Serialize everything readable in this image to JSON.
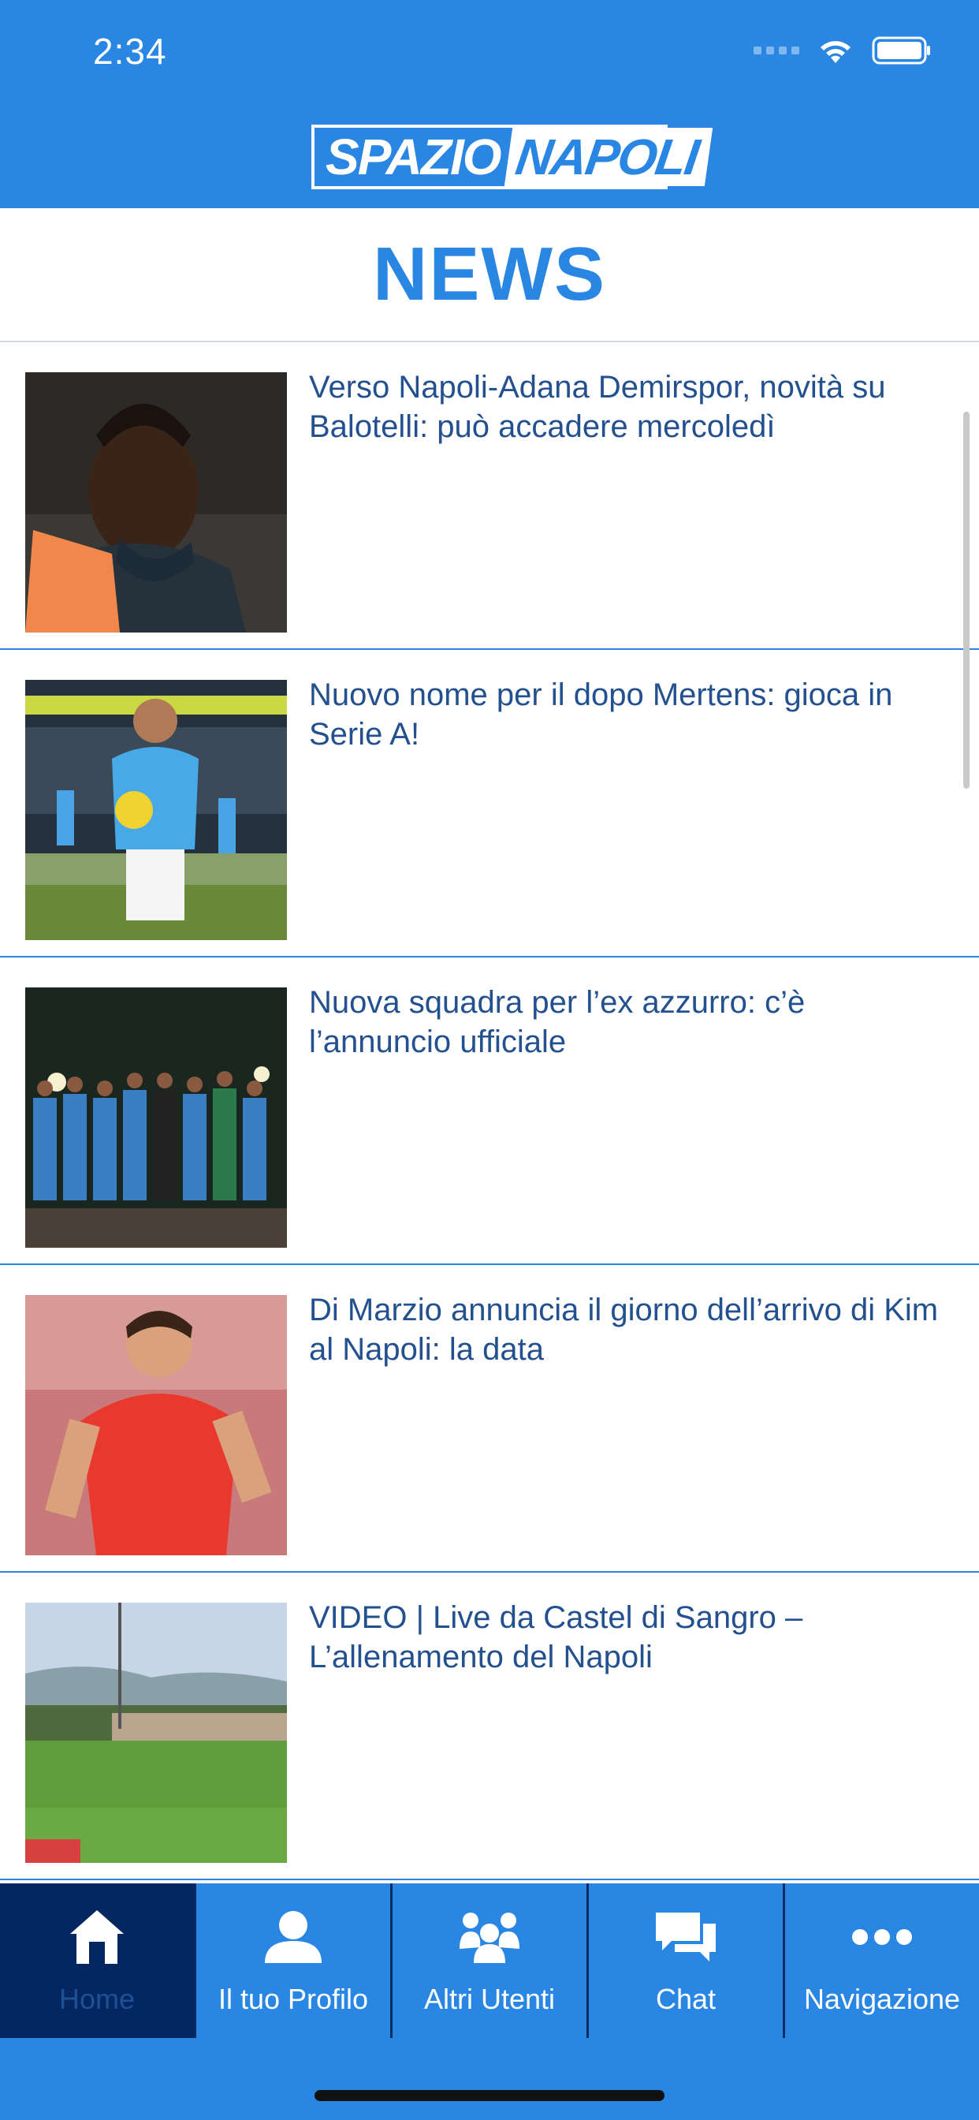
{
  "status_bar": {
    "time": "2:34"
  },
  "header": {
    "logo_part1": "SPAZIO",
    "logo_part2": "NAPOLI"
  },
  "page_title": "NEWS",
  "news": [
    {
      "headline": "Verso Napoli-Adana Demirspor, novità su Balotelli: può accadere mercoledì",
      "image": "player-portrait"
    },
    {
      "headline": "Nuovo nome per il dopo Mertens: gioca in Serie A!",
      "image": "player-with-ball"
    },
    {
      "headline": "Nuova squadra per l’ex azzurro: c’è l’annuncio ufficiale",
      "image": "team-celebration"
    },
    {
      "headline": "Di Marzio annuncia il giorno dell’arrivo di Kim al Napoli: la data",
      "image": "player-red-kit"
    },
    {
      "headline": "VIDEO | Live da Castel di Sangro – L’allenamento del Napoli",
      "image": "stadium-field"
    }
  ],
  "tabs": [
    {
      "label": "Home",
      "icon": "home-icon",
      "active": true
    },
    {
      "label": "Il tuo Profilo",
      "icon": "user-icon",
      "active": false
    },
    {
      "label": "Altri Utenti",
      "icon": "users-icon",
      "active": false
    },
    {
      "label": "Chat",
      "icon": "chat-icon",
      "active": false
    },
    {
      "label": "Navigazione",
      "icon": "more-icon",
      "active": false
    }
  ],
  "colors": {
    "brand": "#2a86e3",
    "active_tab": "#052761",
    "headline": "#23508e"
  }
}
